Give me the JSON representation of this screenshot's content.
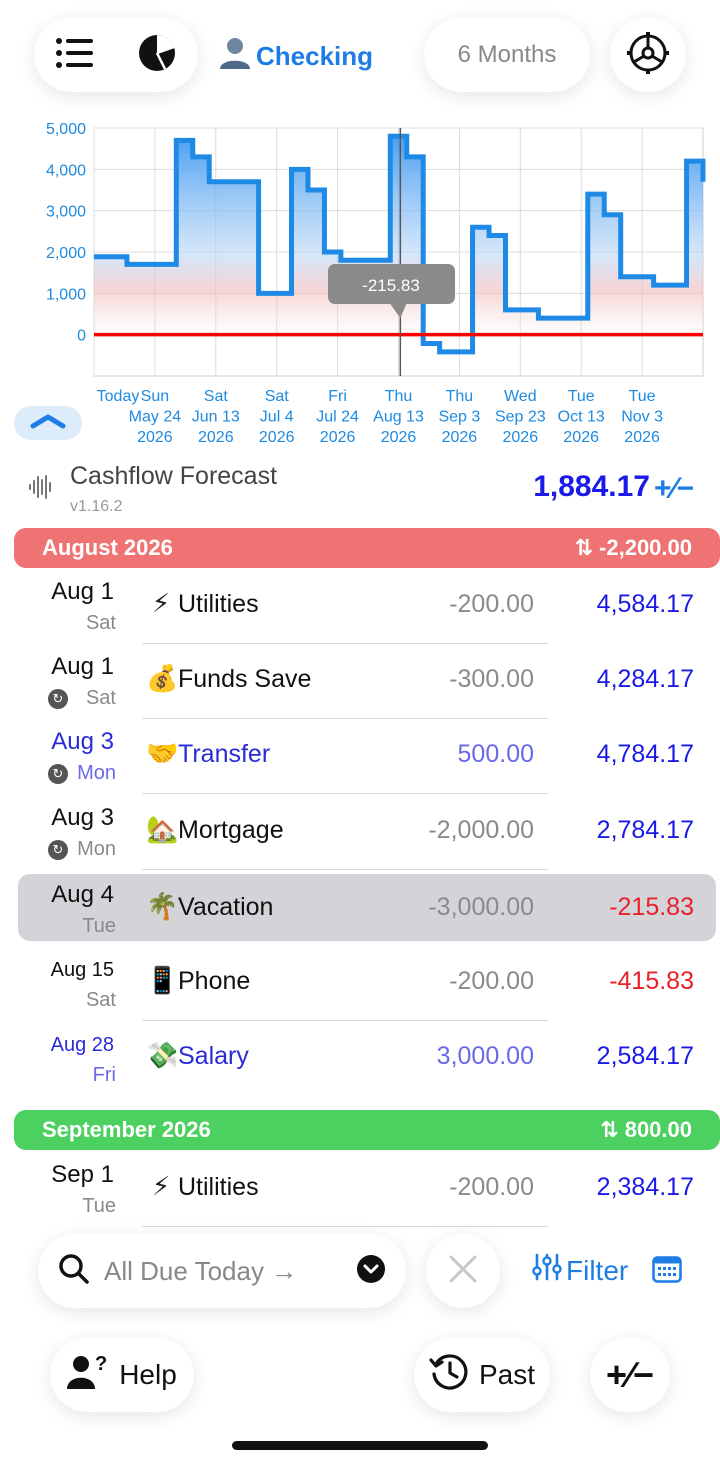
{
  "top": {
    "account_label": "Checking",
    "range_label": "6 Months"
  },
  "chart_data": {
    "type": "line",
    "ylim": [
      -1000,
      5000
    ],
    "yticks": [
      "5,000",
      "4,000",
      "3,000",
      "2,000",
      "1,000",
      "0"
    ],
    "xticks": [
      {
        "l1": "Today",
        "l2": "",
        "l3": ""
      },
      {
        "l1": "Sun",
        "l2": "May 24",
        "l3": "2026"
      },
      {
        "l1": "Sat",
        "l2": "Jun 13",
        "l3": "2026"
      },
      {
        "l1": "Sat",
        "l2": "Jul 4",
        "l3": "2026"
      },
      {
        "l1": "Fri",
        "l2": "Jul 24",
        "l3": "2026"
      },
      {
        "l1": "Thu",
        "l2": "Aug 13",
        "l3": "2026"
      },
      {
        "l1": "Thu",
        "l2": "Sep 3",
        "l3": "2026"
      },
      {
        "l1": "Wed",
        "l2": "Sep 23",
        "l3": "2026"
      },
      {
        "l1": "Tue",
        "l2": "Oct 13",
        "l3": "2026"
      },
      {
        "l1": "Tue",
        "l2": "Nov 3",
        "l3": "2026"
      }
    ],
    "series": [
      {
        "values": [
          1884,
          1884,
          1700,
          1700,
          1700,
          4700,
          4300,
          3700,
          3700,
          3700,
          1000,
          1000,
          4000,
          3500,
          2000,
          1800,
          1800,
          1800,
          4800,
          4300,
          -215,
          -415,
          -415,
          2600,
          2400,
          600,
          600,
          400,
          400,
          400,
          3400,
          2900,
          1400,
          1400,
          1200,
          1200,
          4200,
          3700
        ]
      }
    ],
    "tooltip": "-215.83",
    "baseline_color": "#ff0000",
    "line_color": "#1e8ae6"
  },
  "header": {
    "title": "Cashflow Forecast",
    "version": "v1.16.2",
    "balance": "1,884.17",
    "adjust_symbol": "+∕−"
  },
  "months": [
    {
      "label": "August 2026",
      "total": "⇅ -2,200.00"
    },
    {
      "label": "September 2026",
      "total": "⇅ 800.00"
    }
  ],
  "rows": [
    {
      "date": "Aug 1",
      "dow": "Sat",
      "icon": "⚡",
      "name": "Utilities",
      "amount": "-200.00",
      "running": "4,584.17"
    },
    {
      "date": "Aug 1",
      "dow": "Sat",
      "icon": "💰",
      "name": "Funds Save",
      "amount": "-300.00",
      "running": "4,284.17"
    },
    {
      "date": "Aug 3",
      "dow": "Mon",
      "icon": "🤝",
      "name": "Transfer",
      "amount": "500.00",
      "running": "4,784.17"
    },
    {
      "date": "Aug 3",
      "dow": "Mon",
      "icon": "🏡",
      "name": "Mortgage",
      "amount": "-2,000.00",
      "running": "2,784.17"
    },
    {
      "date": "Aug 4",
      "dow": "Tue",
      "icon": "🌴",
      "name": "Vacation",
      "amount": "-3,000.00",
      "running": "-215.83"
    },
    {
      "date": "Aug 15",
      "dow": "Sat",
      "icon": "📱",
      "name": "Phone",
      "amount": "-200.00",
      "running": "-415.83"
    },
    {
      "date": "Aug 28",
      "dow": "Fri",
      "icon": "💸",
      "name": "Salary",
      "amount": "3,000.00",
      "running": "2,584.17"
    },
    {
      "date": "Sep 1",
      "dow": "Tue",
      "icon": "⚡",
      "name": "Utilities",
      "amount": "-200.00",
      "running": "2,384.17"
    }
  ],
  "bottom": {
    "search_text": "All Due Today →",
    "filter_label": "Filter",
    "help_label": "Help",
    "past_label": "Past",
    "plusminus_label": "+∕−"
  }
}
